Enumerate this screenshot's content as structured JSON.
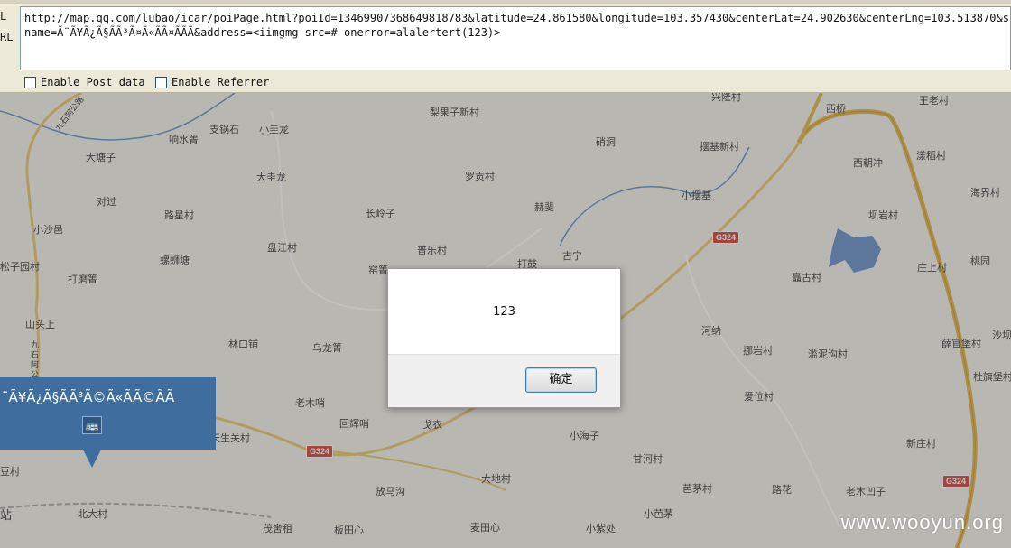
{
  "hackbar": {
    "label_top": "L",
    "label_url": "RL",
    "url_line1": "http://map.qq.com/lubao/icar/poiPage.html?poiId=13469907368649818783&latitude=24.861580&longitude=103.357430&centerLat=24.902630&centerLng=103.513870&scale=",
    "url_line2": "name=Ã¨Ã¥Ã¿Ã§ÃÃ³Ã¤Ã«ÃÃ¤ÃÃÃ&address=<iimgmg src=# onerror=alalertert(123)>",
    "enable_post": "Enable Post data",
    "enable_referrer": "Enable Referrer"
  },
  "map": {
    "places": [
      {
        "name": "兴隆村"
      },
      {
        "name": "王老村"
      },
      {
        "name": "梨果子新村"
      },
      {
        "name": "西桥"
      },
      {
        "name": "支锅石"
      },
      {
        "name": "小圭龙"
      },
      {
        "name": "响水箐"
      },
      {
        "name": "硝洞"
      },
      {
        "name": "摆基新村"
      },
      {
        "name": "漾稻村"
      },
      {
        "name": "大塘子"
      },
      {
        "name": "西朝冲"
      },
      {
        "name": "大圭龙"
      },
      {
        "name": "罗贡村"
      },
      {
        "name": "海界村"
      },
      {
        "name": "对过"
      },
      {
        "name": "小摆基"
      },
      {
        "name": "路星村"
      },
      {
        "name": "长岭子"
      },
      {
        "name": "赫斐"
      },
      {
        "name": "坝岩村"
      },
      {
        "name": "小沙邑"
      },
      {
        "name": "盘江村"
      },
      {
        "name": "普乐村"
      },
      {
        "name": "古宁"
      },
      {
        "name": "螺蛳塘"
      },
      {
        "name": "打鼓"
      },
      {
        "name": "桃园"
      },
      {
        "name": "松子园村"
      },
      {
        "name": "窑箐"
      },
      {
        "name": "庄上村"
      },
      {
        "name": "打磨箐"
      },
      {
        "name": "矗古村"
      },
      {
        "name": "山头上"
      },
      {
        "name": "河纳"
      },
      {
        "name": "林口铺"
      },
      {
        "name": "乌龙箐"
      },
      {
        "name": "挪岩村"
      },
      {
        "name": "滥泥沟村"
      },
      {
        "name": "薛官堡村"
      },
      {
        "name": "沙坝"
      },
      {
        "name": "爱位村"
      },
      {
        "name": "杜旗堡村"
      },
      {
        "name": "老木哨"
      },
      {
        "name": "回辉哨"
      },
      {
        "name": "戈衣"
      },
      {
        "name": "小海子"
      },
      {
        "name": "新庄村"
      },
      {
        "name": "天生关村"
      },
      {
        "name": "甘河村"
      },
      {
        "name": "豆村"
      },
      {
        "name": "大地村"
      },
      {
        "name": "放马沟"
      },
      {
        "name": "芭茅村"
      },
      {
        "name": "路花"
      },
      {
        "name": "老木凹子"
      },
      {
        "name": "北大村"
      },
      {
        "name": "小芭茅"
      },
      {
        "name": "茂舍租"
      },
      {
        "name": "板田心"
      },
      {
        "name": "麦田心"
      },
      {
        "name": "小紫处"
      },
      {
        "name": "站"
      },
      {
        "name": "九石阿公路"
      },
      {
        "name": "九石阿公路"
      }
    ],
    "shields": [
      "G324",
      "G324",
      "G324"
    ],
    "info_popup_text": "¨Ã¥Ã¿Ã§ÃÃ³Ã©Ã«ÃÃ©ÃÃ",
    "info_popup_icon": "bus-icon"
  },
  "dialog": {
    "message": "123",
    "ok_label": "确定"
  },
  "watermark": "www.wooyun.org",
  "colors": {
    "popup_blue": "#3f6d9e",
    "road_yellow": "#e2b548",
    "shield_red": "#d2453a",
    "river_blue": "#6a8fc8",
    "button_border": "#3c7fb1"
  }
}
